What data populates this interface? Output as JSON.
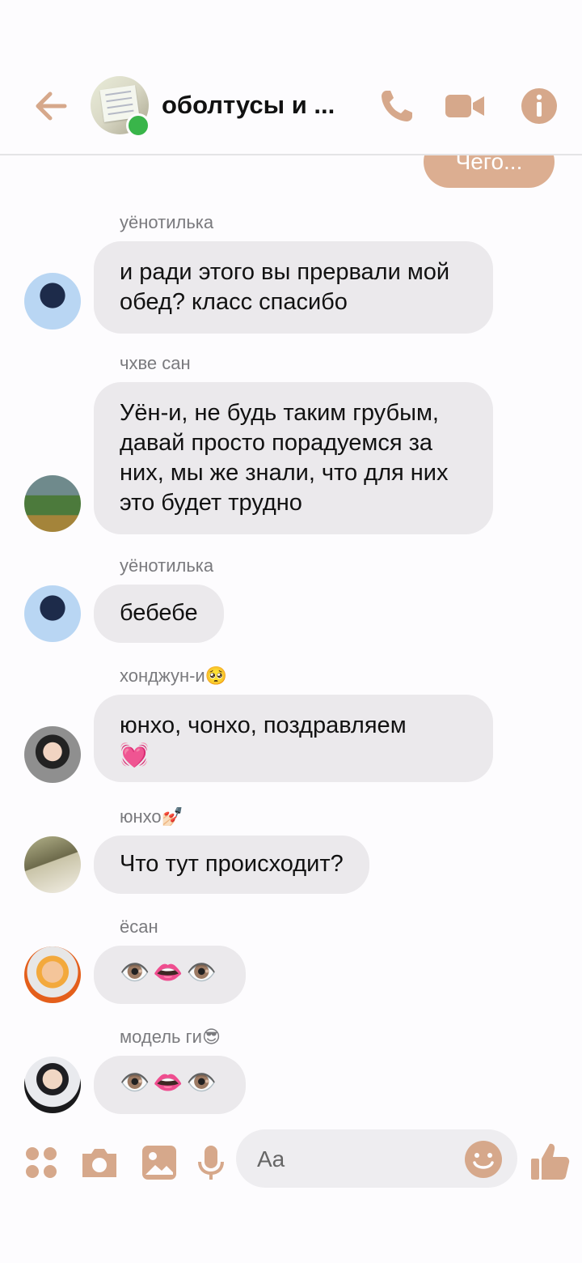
{
  "header": {
    "title": "оболтусы и ...",
    "online": true,
    "icons": [
      "back-arrow-icon",
      "phone-icon",
      "video-camera-icon",
      "info-icon"
    ]
  },
  "partial_message": {
    "text": "Чего..."
  },
  "messages": [
    {
      "sender": "уёнотилька",
      "text": "и ради этого вы прервали мой обед? класс спасибо"
    },
    {
      "sender": "чхве сан",
      "text": "Уён-и, не будь таким грубым, давай просто порадуемся за них, мы же знали, что для них это будет трудно"
    },
    {
      "sender": "уёнотилька",
      "text": "бебебе"
    },
    {
      "sender": "хонджун-и",
      "sender_emoji": "🥺",
      "text": "юнхо, чонхо, поздравляем",
      "text_emoji": "💓"
    },
    {
      "sender": "юнхо",
      "sender_emoji": "💅🏻",
      "text": "Что тут происходит?"
    },
    {
      "sender": "ёсан",
      "text": "👁️👄👁️"
    },
    {
      "sender": "модель ги",
      "sender_emoji": "😎",
      "text": "👁️👄👁️"
    }
  ],
  "composer": {
    "placeholder": "Aa",
    "icons": [
      "apps-icon",
      "camera-icon",
      "gallery-icon",
      "microphone-icon",
      "emoji-icon",
      "thumbs-up-icon"
    ]
  },
  "colors": {
    "accent": "#d6a88b",
    "bubble": "#ebe9ec",
    "online": "#39b54a"
  }
}
